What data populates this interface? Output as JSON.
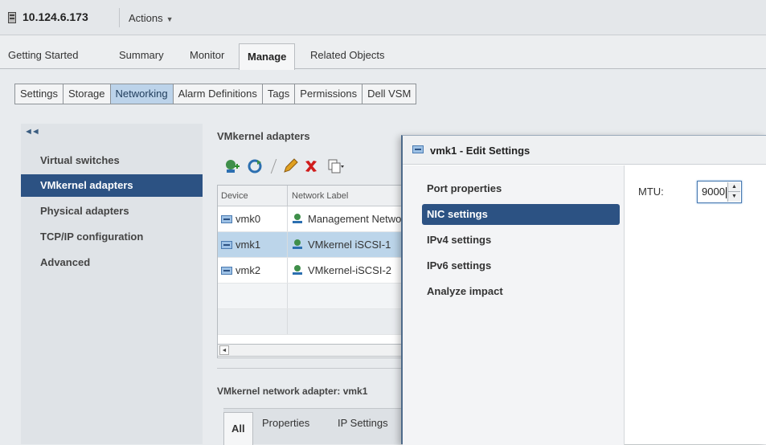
{
  "host": {
    "name": "10.124.6.173",
    "actions_label": "Actions"
  },
  "main_tabs": [
    "Getting Started",
    "Summary",
    "Monitor",
    "Manage",
    "Related Objects"
  ],
  "sub_tabs": [
    "Settings",
    "Storage",
    "Networking",
    "Alarm Definitions",
    "Tags",
    "Permissions",
    "Dell VSM"
  ],
  "left_nav": [
    "Virtual switches",
    "VMkernel adapters",
    "Physical adapters",
    "TCP/IP configuration",
    "Advanced"
  ],
  "panel": {
    "title": "VMkernel adapters",
    "columns": {
      "device": "Device",
      "label": "Network Label"
    },
    "rows": [
      {
        "device": "vmk0",
        "label": "Management Network"
      },
      {
        "device": "vmk1",
        "label": "VMkernel iSCSI-1"
      },
      {
        "device": "vmk2",
        "label": "VMkernel-iSCSI-2"
      }
    ],
    "detail_title": "VMkernel network adapter: vmk1",
    "detail_tabs": [
      "All",
      "Properties",
      "IP Settings"
    ]
  },
  "dialog": {
    "title": "vmk1 - Edit Settings",
    "nav": [
      "Port properties",
      "NIC settings",
      "IPv4 settings",
      "IPv6 settings",
      "Analyze impact"
    ],
    "mtu_label": "MTU:",
    "mtu_value": "9000"
  },
  "colors": {
    "accent": "#2c5283",
    "selected_row": "#bcd5ea",
    "active_subtab": "#bcd3ea"
  }
}
